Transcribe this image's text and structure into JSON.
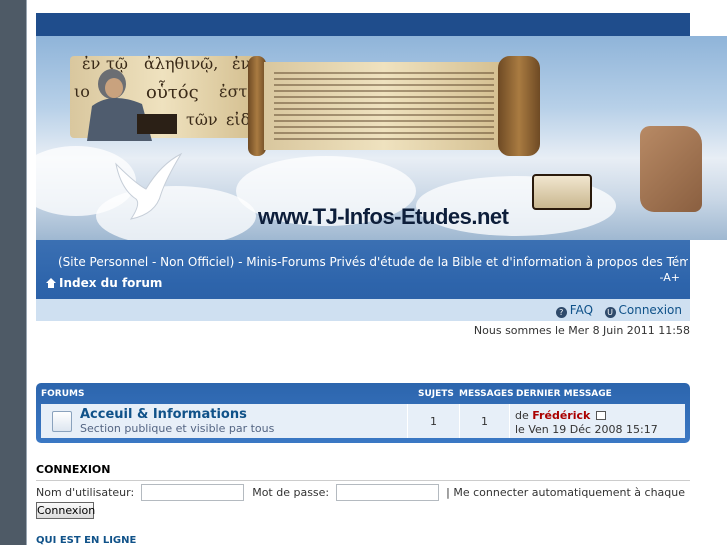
{
  "header": {
    "site_url": "www.TJ-Infos-Etudes.net",
    "greek_text": [
      "ἐν",
      "τῷ",
      "ἀληθινῷ,",
      "ἐν",
      "οὗτός",
      "ἐστ",
      "τῶν",
      "εἰδ",
      "ιο"
    ],
    "site_description": "(Site Personnel - Non Officiel) - Minis-Forums Privés d'étude de la Bible et d'information à propos des Témoins de",
    "font_resize": "-A+",
    "index_link": "Index du forum",
    "faq_link": "FAQ",
    "login_link": "Connexion"
  },
  "date_line": "Nous sommes le Mer 8 Juin 2011 11:58",
  "forum_table": {
    "headers": {
      "forums": "FORUMS",
      "topics": "SUJETS",
      "posts": "MESSAGES",
      "last_post": "DERNIER MESSAGE"
    },
    "rows": [
      {
        "title": "Acceuil & Informations",
        "description": "Section publique et visible par tous",
        "topics": "1",
        "posts": "1",
        "last_by_prefix": "de",
        "last_author": "Frédérick",
        "last_time": "le Ven 19 Déc 2008 15:17"
      }
    ]
  },
  "login": {
    "heading": "CONNEXION",
    "username_label": "Nom d'utilisateur:",
    "password_label": "Mot de passe:",
    "remember_label": "| Me connecter automatiquement à chaque visite",
    "submit_label": "Connexion"
  },
  "online": {
    "heading": "QUI EST EN LIGNE"
  },
  "colors": {
    "nav_blue": "#2d64ab",
    "top_bar": "#1f4d8c",
    "link": "#105289",
    "author": "#aa0000"
  }
}
